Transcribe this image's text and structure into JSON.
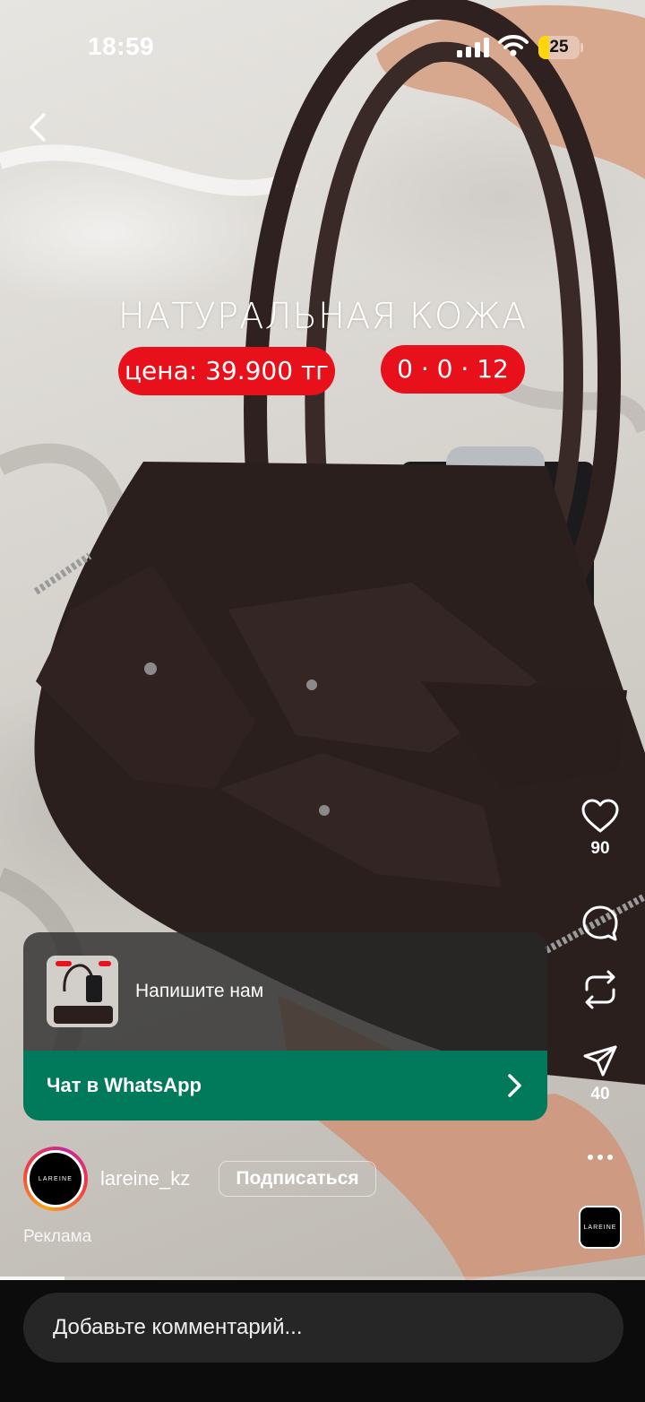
{
  "status_bar": {
    "time": "18:59",
    "battery_level": "25",
    "battery_fill_fraction": 0.25,
    "battery_color": "#ffd60a"
  },
  "icons": {
    "back": "chevron-left-icon",
    "like": "heart-icon",
    "comment": "speech-bubble-icon",
    "repost": "repost-icon",
    "share": "paper-plane-icon",
    "more": "ellipsis-icon",
    "cta": "chevron-right-icon"
  },
  "video_overlay": {
    "headline": "НАТУРАЛЬНАЯ КОЖА",
    "price": "цена: 39.900 тг",
    "timer": "0 · 0 · 12",
    "pill_color": "#e8101b"
  },
  "actions": {
    "likes_count": "90",
    "shares_count": "40"
  },
  "ad_card": {
    "title": "Напишите нам",
    "cta_label": "Чат в WhatsApp",
    "cta_color": "#017a5c"
  },
  "author": {
    "avatar_text": "LAREINE",
    "username": "lareine_kz",
    "follow_label": "Подписаться",
    "sponsored_label": "Реклама"
  },
  "reel_thumb_text": "LAREINE",
  "playback": {
    "progress_fraction": 0.1
  },
  "comment": {
    "placeholder": "Добавьте комментарий..."
  }
}
